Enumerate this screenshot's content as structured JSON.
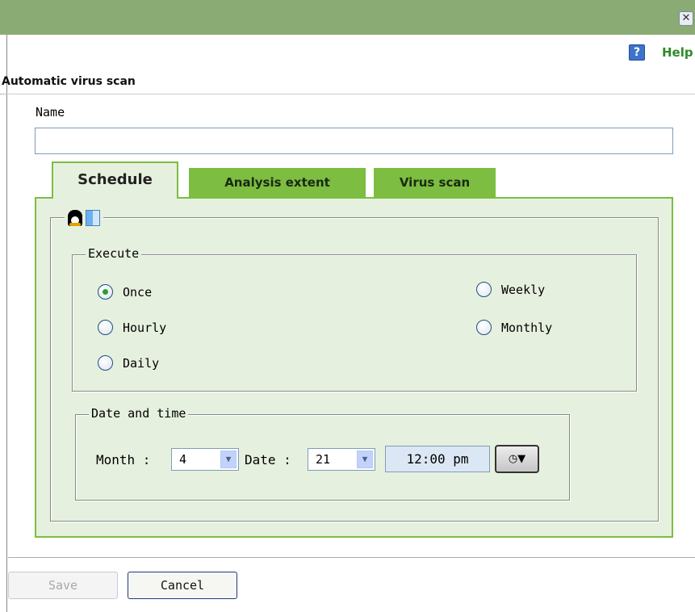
{
  "window": {
    "close_glyph": "✕"
  },
  "dialog": {
    "title": "Automatic virus scan",
    "help_icon_glyph": "?",
    "help_label": "Help"
  },
  "form": {
    "name_label": "Name",
    "name_value": "",
    "name_placeholder": ""
  },
  "tabs": [
    {
      "label": "Schedule",
      "active": true
    },
    {
      "label": "Analysis extent",
      "active": false
    },
    {
      "label": "Virus scan",
      "active": false
    }
  ],
  "os_icons": [
    "linux-icon",
    "mac-icon"
  ],
  "execute": {
    "legend": "Execute",
    "options": [
      {
        "label": "Once",
        "checked": true
      },
      {
        "label": "Hourly",
        "checked": false
      },
      {
        "label": "Daily",
        "checked": false
      },
      {
        "label": "Weekly",
        "checked": false
      },
      {
        "label": "Monthly",
        "checked": false
      }
    ]
  },
  "date_time": {
    "legend": "Date and time",
    "month_label": "Month :",
    "month_value": "4",
    "date_label": "Date :",
    "date_value": "21",
    "time_value": "12:00 pm",
    "time_button_glyph": "◷▼"
  },
  "buttons": {
    "save_label": "Save",
    "save_enabled": false,
    "cancel_label": "Cancel"
  },
  "colors": {
    "titlebar": "#8aab74",
    "tab_active_bg": "#e6f0de",
    "tab_inactive_bg": "#7cbd42",
    "help_text": "#2f8a2a"
  }
}
